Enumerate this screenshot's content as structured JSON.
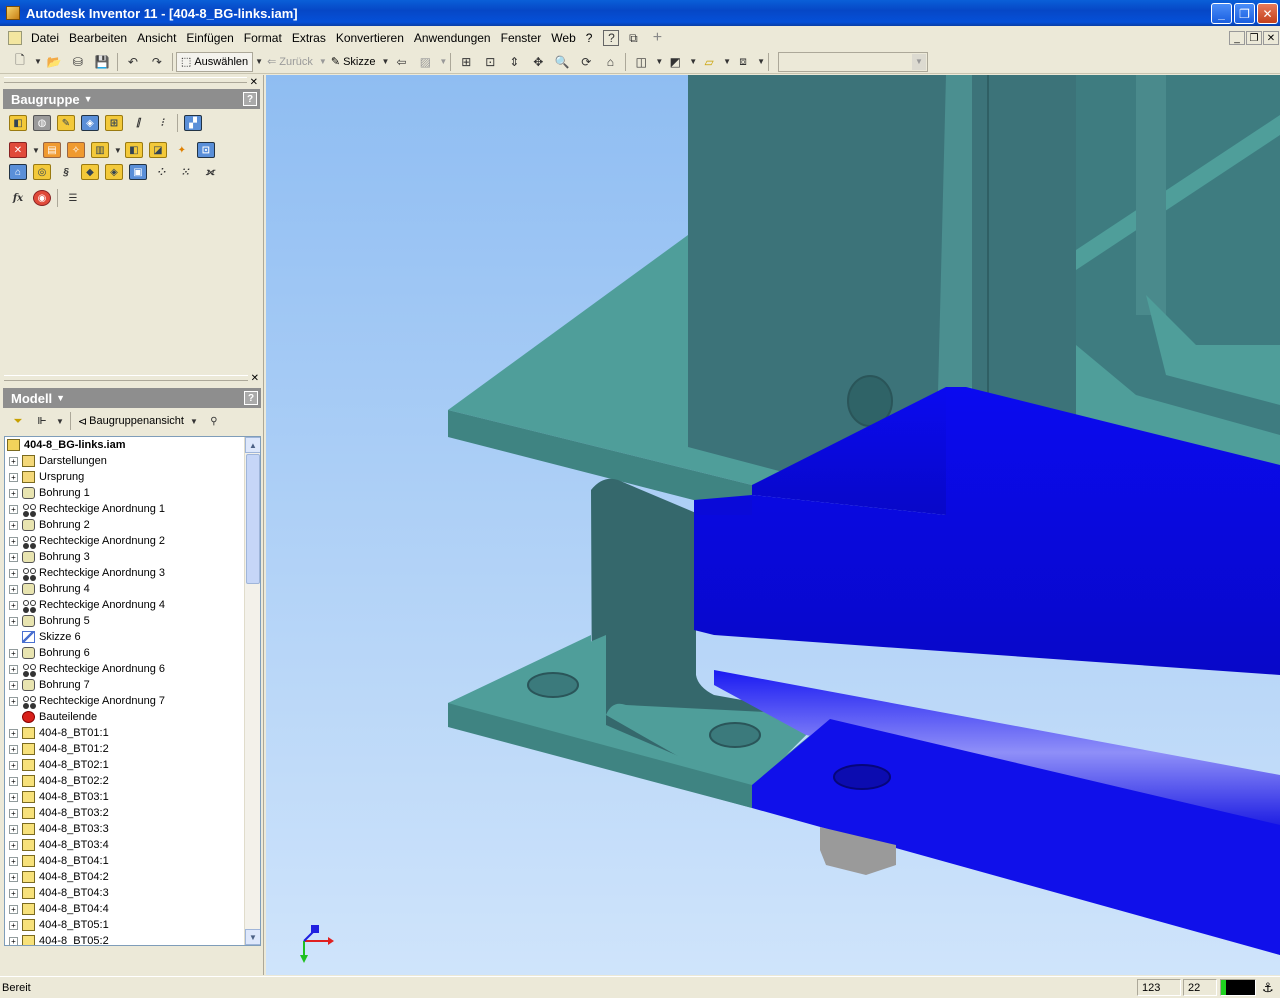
{
  "window": {
    "title": "Autodesk Inventor 11 - [404-8_BG-links.iam]"
  },
  "menu": [
    "Datei",
    "Bearbeiten",
    "Ansicht",
    "Einfügen",
    "Format",
    "Extras",
    "Konvertieren",
    "Anwendungen",
    "Fenster",
    "Web",
    "?"
  ],
  "toolbar": {
    "select_label": "Auswählen",
    "back_label": "Zurück",
    "sketch_label": "Skizze",
    "combo_value": ""
  },
  "panel_assembly": {
    "title": "Baugruppe",
    "help": "?"
  },
  "panel_model": {
    "title": "Modell",
    "view_label": "Baugruppenansicht",
    "help": "?"
  },
  "tree": {
    "root": "404-8_BG-links.iam",
    "items": [
      {
        "label": "Darstellungen",
        "icon": "folder-icon",
        "expand": true
      },
      {
        "label": "Ursprung",
        "icon": "folder-icon",
        "expand": true
      },
      {
        "label": "Bohrung 1",
        "icon": "hole-icon",
        "expand": true
      },
      {
        "label": "Rechteckige Anordnung 1",
        "icon": "pattern-icon",
        "expand": true
      },
      {
        "label": "Bohrung 2",
        "icon": "hole-icon",
        "expand": true
      },
      {
        "label": "Rechteckige Anordnung 2",
        "icon": "pattern-icon",
        "expand": true
      },
      {
        "label": "Bohrung 3",
        "icon": "hole-icon",
        "expand": true
      },
      {
        "label": "Rechteckige Anordnung 3",
        "icon": "pattern-icon",
        "expand": true
      },
      {
        "label": "Bohrung 4",
        "icon": "hole-icon",
        "expand": true
      },
      {
        "label": "Rechteckige Anordnung 4",
        "icon": "pattern-icon",
        "expand": true
      },
      {
        "label": "Bohrung 5",
        "icon": "hole-icon",
        "expand": true
      },
      {
        "label": "Skizze 6",
        "icon": "sketch-icon",
        "expand": false
      },
      {
        "label": "Bohrung 6",
        "icon": "hole-icon",
        "expand": true
      },
      {
        "label": "Rechteckige Anordnung 6",
        "icon": "pattern-icon",
        "expand": true
      },
      {
        "label": "Bohrung 7",
        "icon": "hole-icon",
        "expand": true
      },
      {
        "label": "Rechteckige Anordnung 7",
        "icon": "pattern-icon",
        "expand": true
      },
      {
        "label": "Bauteilende",
        "icon": "end-of-part-icon",
        "expand": false
      },
      {
        "label": "404-8_BT01:1",
        "icon": "part-icon",
        "expand": true
      },
      {
        "label": "404-8_BT01:2",
        "icon": "part-icon",
        "expand": true
      },
      {
        "label": "404-8_BT02:1",
        "icon": "part-icon",
        "expand": true
      },
      {
        "label": "404-8_BT02:2",
        "icon": "part-icon",
        "expand": true
      },
      {
        "label": "404-8_BT03:1",
        "icon": "part-icon",
        "expand": true
      },
      {
        "label": "404-8_BT03:2",
        "icon": "part-icon",
        "expand": true
      },
      {
        "label": "404-8_BT03:3",
        "icon": "part-icon",
        "expand": true
      },
      {
        "label": "404-8_BT03:4",
        "icon": "part-icon",
        "expand": true
      },
      {
        "label": "404-8_BT04:1",
        "icon": "part-icon",
        "expand": true
      },
      {
        "label": "404-8_BT04:2",
        "icon": "part-icon",
        "expand": true
      },
      {
        "label": "404-8_BT04:3",
        "icon": "part-icon",
        "expand": true
      },
      {
        "label": "404-8_BT04:4",
        "icon": "part-icon",
        "expand": true
      },
      {
        "label": "404-8_BT05:1",
        "icon": "part-icon",
        "expand": true
      },
      {
        "label": "404-8_BT05:2",
        "icon": "part-icon",
        "expand": true
      }
    ]
  },
  "status": {
    "text": "Bereit",
    "value1": "123",
    "value2": "22"
  },
  "colors": {
    "teal": "#4f9e9a",
    "blue": "#1010f0",
    "titlebar": "#0a5fd8"
  }
}
